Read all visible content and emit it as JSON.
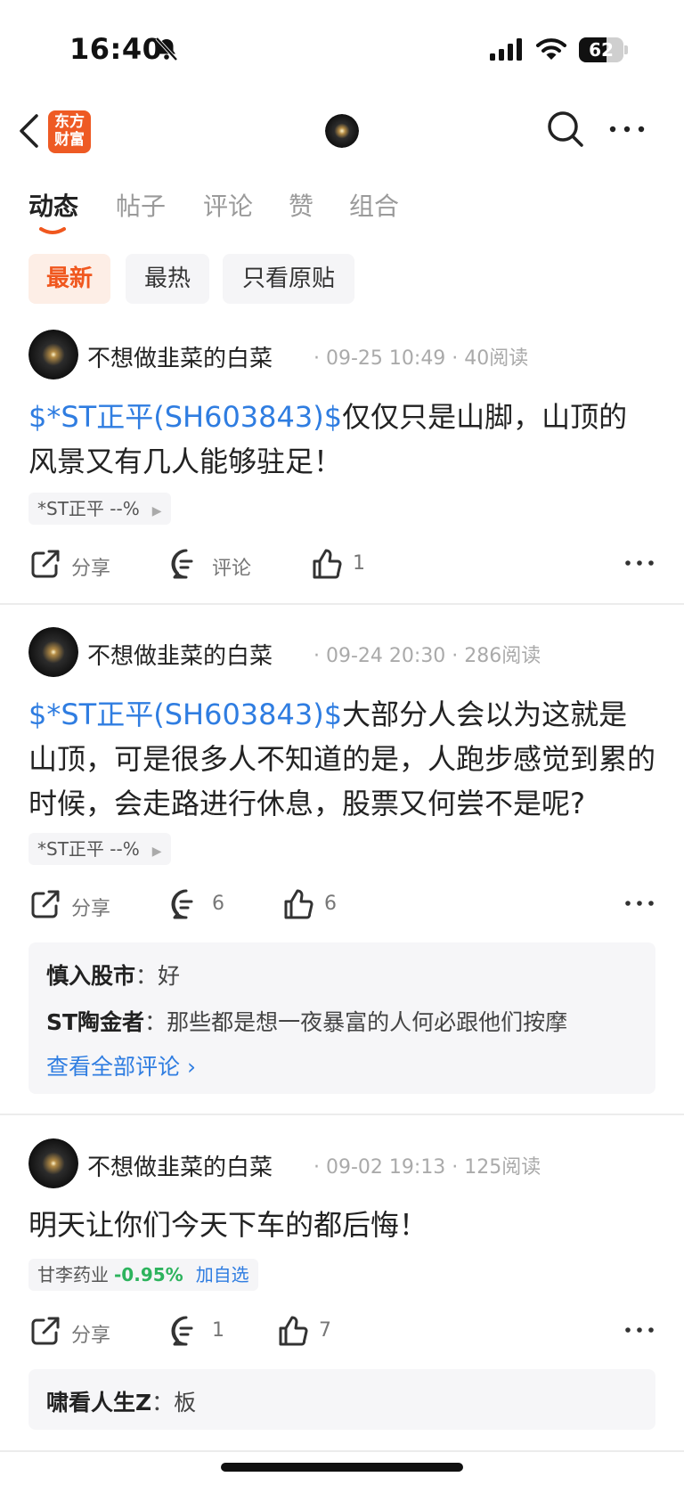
{
  "status_bar": {
    "time": "16:40",
    "battery": "62",
    "battery_level": 0.62
  },
  "nav": {
    "logo_text": "东方财富",
    "logo_line1": "东方",
    "logo_line2": "财富"
  },
  "tabs": [
    {
      "label": "动态",
      "active": true
    },
    {
      "label": "帖子",
      "active": false
    },
    {
      "label": "评论",
      "active": false
    },
    {
      "label": "赞",
      "active": false
    },
    {
      "label": "组合",
      "active": false
    }
  ],
  "filters": [
    {
      "label": "最新",
      "active": true
    },
    {
      "label": "最热",
      "active": false
    },
    {
      "label": "只看原贴",
      "active": false
    }
  ],
  "posts": [
    {
      "author": "不想做韭菜的白菜",
      "meta": "· 09-25 10:49 · 40阅读",
      "stock_link": "$*ST正平(SH603843)$",
      "text": "仅仅只是山脚，山顶的风景又有几人能够驻足！",
      "tag": "*ST正平 --%",
      "share": "分享",
      "comment": "评论",
      "likes": "1"
    },
    {
      "author": "不想做韭菜的白菜",
      "meta": "· 09-24 20:30 · 286阅读",
      "stock_link": "$*ST正平(SH603843)$",
      "text": "大部分人会以为这就是山顶，可是很多人不知道的是，人跑步感觉到累的时候，会走路进行休息，股票又何尝不是呢?",
      "tag": "*ST正平 --%",
      "share": "分享",
      "comment": "6",
      "likes": "6",
      "comments": [
        {
          "user": "慎入股市",
          "sep": "：",
          "text": "好"
        },
        {
          "user": "ST陶金者",
          "sep": "：",
          "text": "那些都是想一夜暴富的人何必跟他们按摩"
        }
      ],
      "view_all": "查看全部评论 ›"
    },
    {
      "author": "不想做韭菜的白菜",
      "meta": "· 09-02 19:13 · 125阅读",
      "text": "明天让你们今天下车的都后悔！",
      "tag_name": "甘李药业",
      "tag_change": "-0.95%",
      "tag_add": "加自选",
      "share": "分享",
      "comment": "1",
      "likes": "7",
      "comments": [
        {
          "user": "啸看人生Z",
          "sep": "：",
          "text": "板"
        }
      ]
    }
  ],
  "colors": {
    "accent": "#f0571e",
    "link": "#2f7de1",
    "green": "#2db35d"
  }
}
